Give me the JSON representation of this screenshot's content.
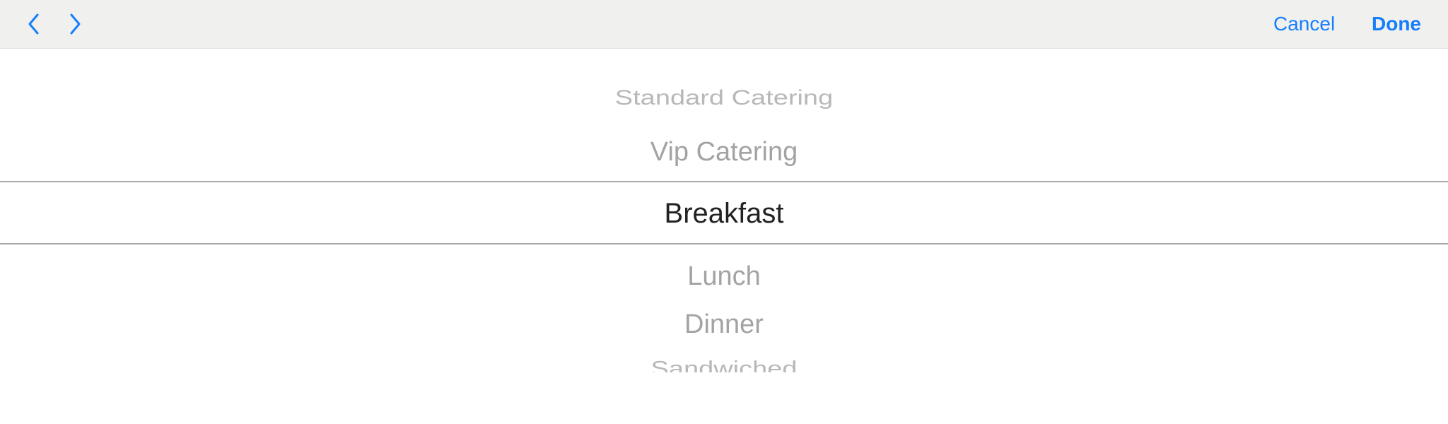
{
  "toolbar": {
    "prev_icon": "chevron-left-icon",
    "next_icon": "chevron-right-icon",
    "cancel_label": "Cancel",
    "done_label": "Done",
    "accent_color": "#157efb",
    "background_color": "#f0f0ef"
  },
  "picker": {
    "items": [
      "Standard Catering",
      "Vip Catering",
      "Breakfast",
      "Lunch",
      "Dinner",
      "Sandwiched"
    ],
    "selected": "Breakfast",
    "selected_color": "#222222",
    "unselected_color": "#a3a3a3"
  }
}
